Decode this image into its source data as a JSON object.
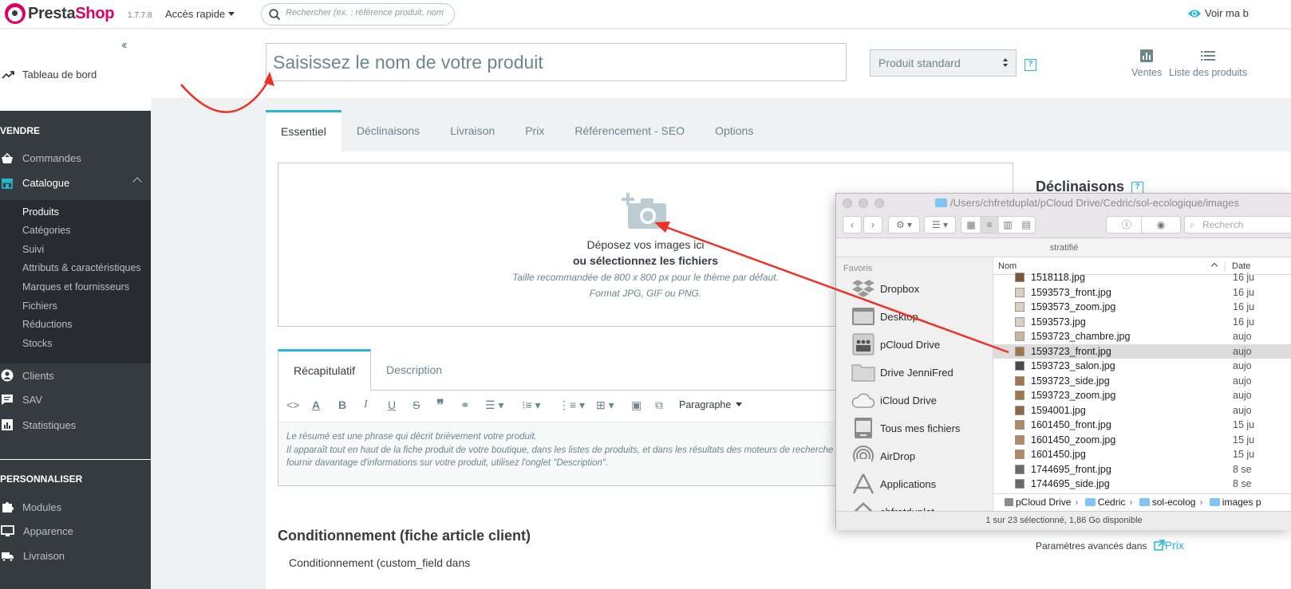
{
  "topbar": {
    "logo_presta": "Presta",
    "logo_shop": "Shop",
    "version": "1.7.7.8",
    "quick_access": "Accès rapide",
    "search_placeholder": "Rechercher (ex. : référence produit, nom",
    "view_shop": "Voir ma b"
  },
  "sidebar": {
    "collapse": "‹‹",
    "dashboard": "Tableau de bord",
    "section_sell": "VENDRE",
    "orders": "Commandes",
    "catalog": "Catalogue",
    "catalog_sub": [
      "Produits",
      "Catégories",
      "Suivi",
      "Attributs & caractéristiques",
      "Marques et fournisseurs",
      "Fichiers",
      "Réductions",
      "Stocks"
    ],
    "customers": "Clients",
    "sav": "SAV",
    "stats": "Statistiques",
    "section_customize": "PERSONNALISER",
    "modules": "Modules",
    "appearance": "Apparence",
    "shipping": "Livraison"
  },
  "header": {
    "name_placeholder": "Saisissez le nom de votre produit",
    "product_type": "Produit standard",
    "help": "?",
    "sales": "Ventes",
    "product_list": "Liste des produits"
  },
  "tabs": [
    "Essentiel",
    "Déclinaisons",
    "Livraison",
    "Prix",
    "Référencement - SEO",
    "Options"
  ],
  "dropzone": {
    "line1": "Déposez vos images ici",
    "line2": "ou sélectionnez les fichiers",
    "line3": "Taille recommandée de 800 x 800 px pour le thème par défaut.",
    "line4": "Format JPG, GIF ou PNG."
  },
  "subtabs": [
    "Récapitulatif",
    "Description"
  ],
  "editor": {
    "paragraph": "Paragraphe",
    "line1": "Le résumé est une phrase qui décrit brièvement votre produit.",
    "line2": "Il apparaît tout en haut de la fiche produit de votre boutique, dans les listes de produits, et dans les résultats des moteurs de recherche",
    "line3": "fournir davantage d'informations sur votre produit, utilisez l'onglet \"Description\"."
  },
  "conditioning": {
    "title": "Conditionnement (fiche article client)",
    "field": "Conditionnement (custom_field dans"
  },
  "right_panel": {
    "declinaisons_title": "Déclinaisons",
    "advanced": "Paramètres avancés dans",
    "prix_link": "Prix"
  },
  "finder": {
    "path": "/Users/chfretduplat/pCloud Drive/Cedric/sol-ecologique/images",
    "search_placeholder": "Recherch",
    "tag_label": "stratifié",
    "favorites_label": "Favoris",
    "sidebar_items": [
      "Dropbox",
      "Desktop",
      "pCloud Drive",
      "Drive JenniFred",
      "iCloud Drive",
      "Tous mes fichiers",
      "AirDrop",
      "Applications",
      "chfretduplat"
    ],
    "col_name": "Nom",
    "col_date": "Date",
    "files": [
      {
        "name": "1518118.jpg",
        "date": "16 ju"
      },
      {
        "name": "1593573_front.jpg",
        "date": "16 ju"
      },
      {
        "name": "1593573_zoom.jpg",
        "date": "16 ju"
      },
      {
        "name": "1593573.jpg",
        "date": "16 ju"
      },
      {
        "name": "1593723_chambre.jpg",
        "date": "aujo"
      },
      {
        "name": "1593723_front.jpg",
        "date": "aujo"
      },
      {
        "name": "1593723_salon.jpg",
        "date": "aujo"
      },
      {
        "name": "1593723_side.jpg",
        "date": "aujo"
      },
      {
        "name": "1593723_zoom.jpg",
        "date": "aujo"
      },
      {
        "name": "1594001.jpg",
        "date": "aujo"
      },
      {
        "name": "1601450_front.jpg",
        "date": "15 ju"
      },
      {
        "name": "1601450_zoom.jpg",
        "date": "15 ju"
      },
      {
        "name": "1601450.jpg",
        "date": "15 ju"
      },
      {
        "name": "1744695_front.jpg",
        "date": "8 se"
      },
      {
        "name": "1744695_side.jpg",
        "date": "8 se"
      }
    ],
    "selected_file": "1593723_front.jpg",
    "pathbar": [
      "pCloud Drive",
      "Cedric",
      "sol-ecolog",
      "images p"
    ],
    "status": "1 sur 23 sélectionné, 1,86 Go disponible"
  },
  "colors": {
    "accent": "#25b9d7",
    "sidebar_bg": "#363a41",
    "brand": "#df0067",
    "arrow": "#ee3124"
  }
}
